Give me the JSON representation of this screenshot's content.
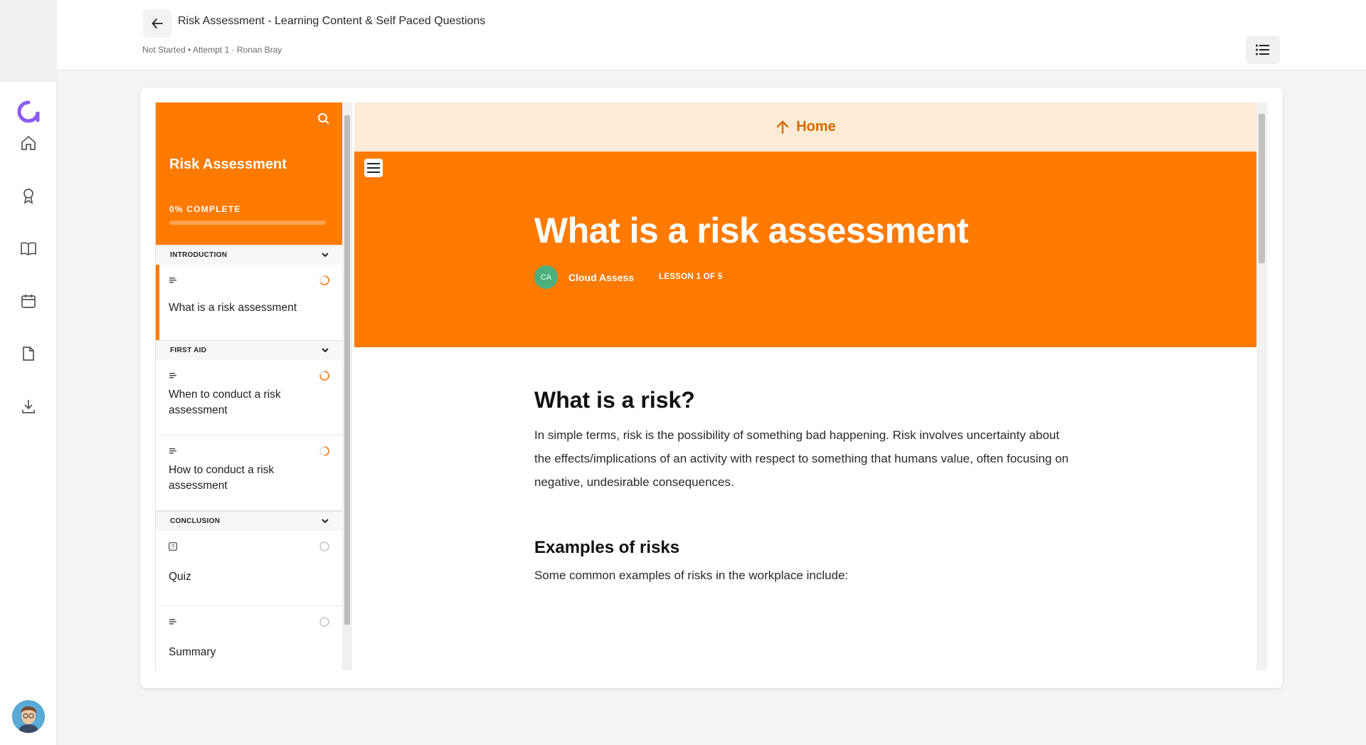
{
  "header": {
    "title": "Risk Assessment - Learning Content & Self Paced Questions",
    "status": "Not Started • Attempt 1 · Ronan Bray"
  },
  "rail": {
    "items": [
      "home-icon",
      "award-icon",
      "book-icon",
      "calendar-icon",
      "document-icon",
      "download-icon"
    ]
  },
  "course": {
    "title": "Risk Assessment",
    "progress_label": "0% COMPLETE",
    "progress": 0,
    "sections": [
      {
        "name": "INTRODUCTION",
        "lessons": [
          {
            "title": "What is a risk assessment",
            "type": "text",
            "status": "in-progress",
            "active": true
          }
        ]
      },
      {
        "name": "FIRST AID",
        "lessons": [
          {
            "title": "When to conduct a risk assessment",
            "type": "text",
            "status": "in-progress"
          },
          {
            "title": "How to conduct a risk assessment",
            "type": "text",
            "status": "in-progress"
          }
        ]
      },
      {
        "name": "CONCLUSION",
        "lessons": [
          {
            "title": "Quiz",
            "type": "quiz",
            "status": "not-started"
          },
          {
            "title": "Summary",
            "type": "text",
            "status": "not-started"
          }
        ]
      }
    ]
  },
  "content": {
    "home_label": "Home",
    "lesson_title": "What is a risk assessment",
    "author_initials": "CA",
    "author_name": "Cloud Assess",
    "lesson_count": "LESSON 1 OF 5",
    "heading1": "What is a risk?",
    "paragraph1": "In simple terms, risk is the possibility of something bad happening. Risk involves uncertainty about the effects/implications of an activity with respect to something that humans value, often focusing on negative, undesirable consequences.",
    "heading2": "Examples of risks",
    "paragraph2": "Some common examples of risks in the workplace include:"
  },
  "colors": {
    "accent": "#ff7a00",
    "home_bar": "#fdebd6",
    "home_text": "#d46a00",
    "logo": "#8b5cf6"
  }
}
